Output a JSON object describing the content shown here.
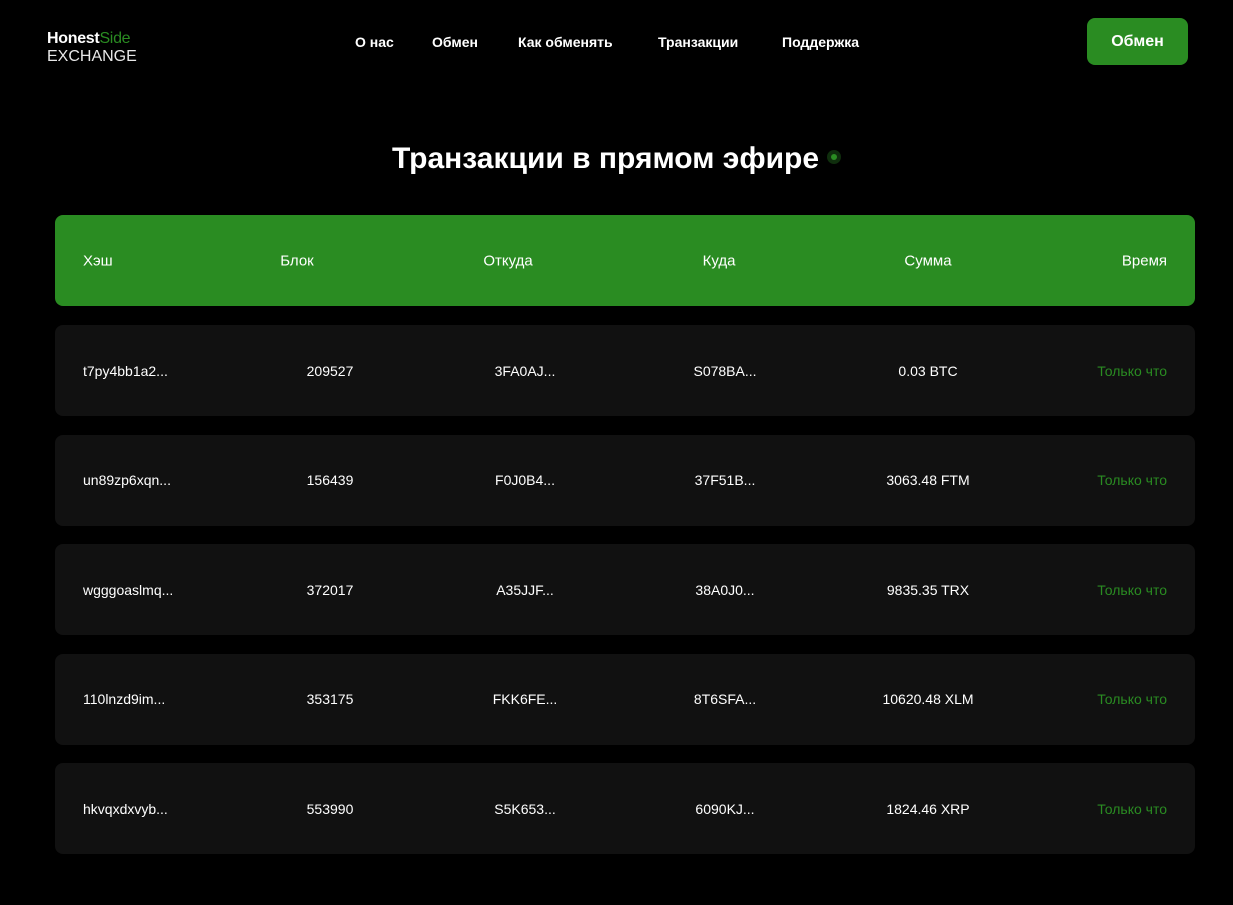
{
  "logo": {
    "honest": "Honest",
    "side": "Side",
    "exchange": "EXCHANGE"
  },
  "nav": [
    "О нас",
    "Обмен",
    "Как обменять",
    "Транзакции",
    "Поддержка"
  ],
  "cta": "Обмен",
  "title": "Транзакции в прямом эфире",
  "columns": [
    "Хэш",
    "Блок",
    "Откуда",
    "Куда",
    "Сумма",
    "Время"
  ],
  "rows": [
    [
      "t7py4bb1a2...",
      "209527",
      "3FA0AJ...",
      "S078BA...",
      "0.03 BTC",
      "Только что"
    ],
    [
      "un89zp6xqn...",
      "156439",
      "F0J0B4...",
      "37F51B...",
      "3063.48 FTM",
      "Только что"
    ],
    [
      "wgggoaslmq...",
      "372017",
      "A35JJF...",
      "38A0J0...",
      "9835.35 TRX",
      "Только что"
    ],
    [
      "110lnzd9im...",
      "353175",
      "FKK6FE...",
      "8T6SFA...",
      "10620.48 XLM",
      "Только что"
    ],
    [
      "hkvqxdxvyb...",
      "553990",
      "S5K653...",
      "6090KJ...",
      "1824.46 XRP",
      "Только что"
    ]
  ],
  "colors": {
    "accent": "#2a8c22",
    "row_bg": "#111111"
  }
}
